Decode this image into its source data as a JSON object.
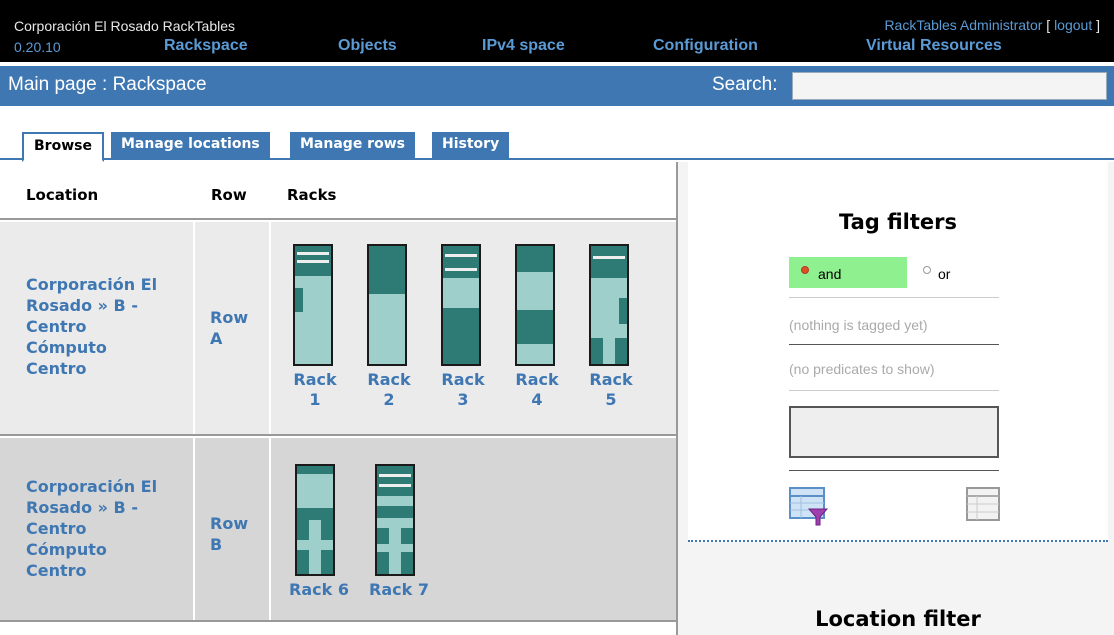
{
  "header": {
    "app_name": "Corporación El Rosado RackTables",
    "version": "0.20.10",
    "nav": [
      "Rackspace",
      "Objects",
      "IPv4 space",
      "Configuration",
      "Virtual Resources"
    ],
    "user": "RackTables Administrator",
    "logout": "logout",
    "bracket_open": "[",
    "bracket_close": "]"
  },
  "pathbar": {
    "path": "Main page : Rackspace",
    "search_label": "Search:",
    "search_value": ""
  },
  "tabs": [
    {
      "label": "Browse",
      "active": true
    },
    {
      "label": "Manage locations",
      "active": false
    },
    {
      "label": "Manage rows",
      "active": false
    },
    {
      "label": "History",
      "active": false
    }
  ],
  "table": {
    "headers": [
      "Location",
      "Row",
      "Racks"
    ],
    "rows": [
      {
        "location_lines": [
          "Corporación El",
          "Rosado » B -",
          "Centro",
          "Cómputo",
          "Centro"
        ],
        "row_lines": [
          "Row",
          "A"
        ],
        "racks": [
          {
            "label_lines": [
              "Rack",
              "1"
            ]
          },
          {
            "label_lines": [
              "Rack",
              "2"
            ]
          },
          {
            "label_lines": [
              "Rack",
              "3"
            ]
          },
          {
            "label_lines": [
              "Rack",
              "4"
            ]
          },
          {
            "label_lines": [
              "Rack",
              "5"
            ]
          }
        ]
      },
      {
        "location_lines": [
          "Corporación El",
          "Rosado » B -",
          "Centro",
          "Cómputo",
          "Centro"
        ],
        "row_lines": [
          "Row",
          "B"
        ],
        "racks": [
          {
            "label_lines": [
              "Rack 6"
            ]
          },
          {
            "label_lines": [
              "Rack 7"
            ]
          }
        ]
      }
    ]
  },
  "tag_filters": {
    "title": "Tag filters",
    "and_label": "and",
    "or_label": "or",
    "selected": "and",
    "nothing_tagged": "(nothing is tagged yet)",
    "no_predicates": "(no predicates to show)",
    "apply_icon": "filter-apply-icon",
    "reset_icon": "filter-reset-icon"
  },
  "location_filter": {
    "title": "Location filter"
  },
  "colors": {
    "accent": "#3f77b3",
    "rack_occupied": "#2e7a74",
    "rack_free": "#9fcfca",
    "and_highlight": "#8ff08f",
    "row_a_bg": "#ebebeb",
    "row_b_bg": "#d6d6d6"
  }
}
